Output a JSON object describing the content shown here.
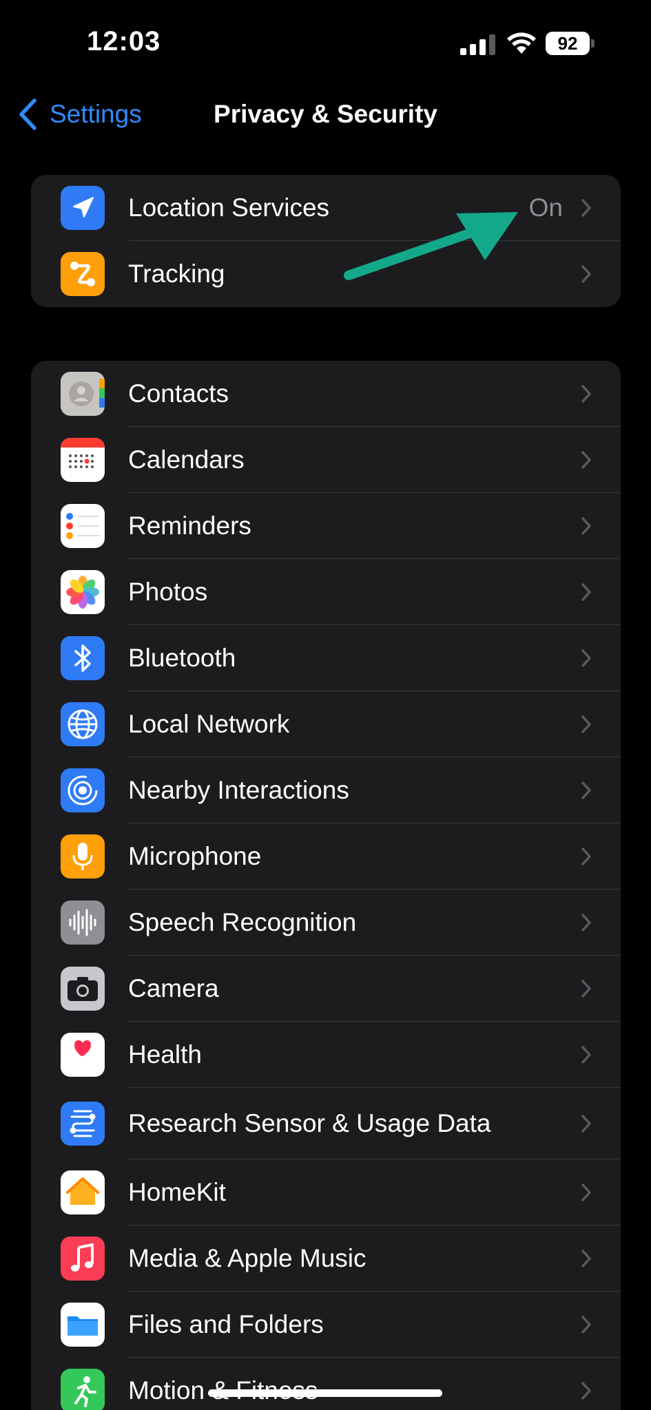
{
  "status_bar": {
    "time": "12:03",
    "battery": "92"
  },
  "nav": {
    "back_label": "Settings",
    "title": "Privacy & Security"
  },
  "group_top": [
    {
      "label": "Location Services",
      "value": "On",
      "icon": "location-arrow-icon",
      "color": "#2f7bf5"
    },
    {
      "label": "Tracking",
      "value": "",
      "icon": "tracking-icon",
      "color": "#ff9f0a"
    }
  ],
  "group_main": [
    {
      "label": "Contacts",
      "icon": "contacts-icon"
    },
    {
      "label": "Calendars",
      "icon": "calendar-icon"
    },
    {
      "label": "Reminders",
      "icon": "reminders-icon"
    },
    {
      "label": "Photos",
      "icon": "photos-icon"
    },
    {
      "label": "Bluetooth",
      "icon": "bluetooth-icon"
    },
    {
      "label": "Local Network",
      "icon": "globe-icon"
    },
    {
      "label": "Nearby Interactions",
      "icon": "nearby-icon"
    },
    {
      "label": "Microphone",
      "icon": "microphone-icon"
    },
    {
      "label": "Speech Recognition",
      "icon": "waveform-icon"
    },
    {
      "label": "Camera",
      "icon": "camera-icon"
    },
    {
      "label": "Health",
      "icon": "heart-icon"
    },
    {
      "label": "Research Sensor & Usage Data",
      "icon": "research-icon"
    },
    {
      "label": "HomeKit",
      "icon": "home-icon"
    },
    {
      "label": "Media & Apple Music",
      "icon": "music-note-icon"
    },
    {
      "label": "Files and Folders",
      "icon": "folder-icon"
    },
    {
      "label": "Motion & Fitness",
      "icon": "fitness-icon"
    }
  ],
  "colors": {
    "accent": "#2f8cff",
    "annotation_arrow": "#14a88a",
    "cell_bg": "#1c1c1e"
  }
}
